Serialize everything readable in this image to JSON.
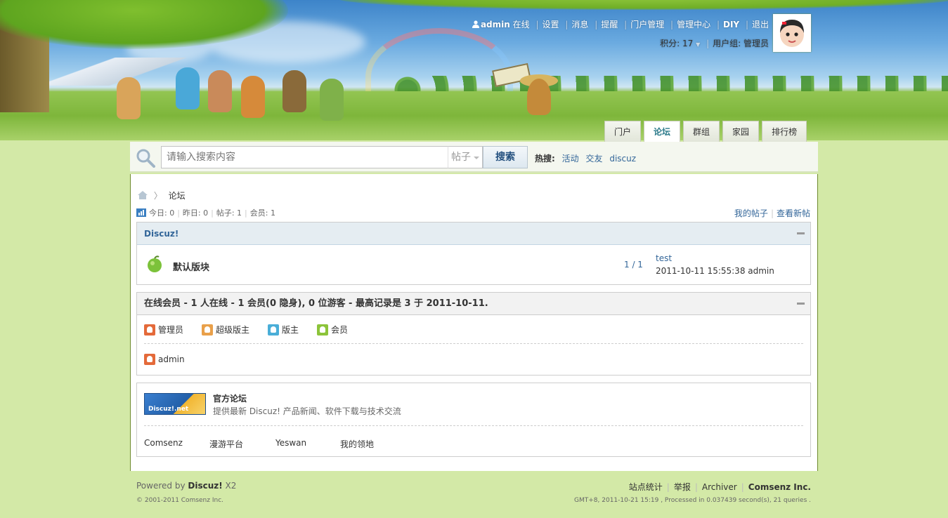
{
  "user_nav": {
    "username": "admin",
    "status": "在线",
    "items": [
      "设置",
      "消息",
      "提醒",
      "门户管理",
      "管理中心",
      "DIY",
      "退出"
    ],
    "credits_label": "积分: 17",
    "usergroup_label": "用户组: 管理员"
  },
  "nav_tabs": [
    {
      "label": "门户",
      "active": false
    },
    {
      "label": "论坛",
      "active": true
    },
    {
      "label": "群组",
      "active": false
    },
    {
      "label": "家园",
      "active": false
    },
    {
      "label": "排行榜",
      "active": false
    }
  ],
  "search": {
    "placeholder": "请输入搜索内容",
    "type": "帖子",
    "button": "搜索",
    "hot_label": "热搜:",
    "hot_terms": [
      "活动",
      "交友",
      "discuz"
    ]
  },
  "breadcrumb": {
    "current": "论坛"
  },
  "stats": {
    "today": "今日: 0",
    "yesterday": "昨日: 0",
    "posts": "帖子: 1",
    "members": "会员: 1"
  },
  "top_links": [
    "我的帖子",
    "查看新帖"
  ],
  "forum_category": {
    "title": "Discuz!",
    "forum": {
      "name": "默认版块",
      "counts": "1 / 1",
      "last_post_title": "test",
      "last_post_info": "2011-10-11 15:55:38 admin"
    }
  },
  "online": {
    "title": "在线会员 - 1 人在线 - 1 会员(0 隐身), 0 位游客 - 最高记录是 3 于 2011-10-11.",
    "legend": [
      {
        "label": "管理员",
        "color": "#e46a3a"
      },
      {
        "label": "超级版主",
        "color": "#e9a04a"
      },
      {
        "label": "版主",
        "color": "#4aaed8"
      },
      {
        "label": "会员",
        "color": "#8cc43a"
      }
    ],
    "users": [
      {
        "name": "admin",
        "color": "#e46a3a"
      }
    ]
  },
  "links": {
    "logo_text": "Discuz!.net",
    "name": "官方论坛",
    "description": "提供最新 Discuz! 产品新闻、软件下载与技术交流",
    "items": [
      "Comsenz",
      "漫游平台",
      "Yeswan",
      "我的领地"
    ]
  },
  "footer": {
    "powered_prefix": "Powered by ",
    "powered_brand": "Discuz!",
    "powered_version": " X2",
    "copyright": "© 2001-2011 Comsenz Inc.",
    "links": [
      "站点统计",
      "举报",
      "Archiver"
    ],
    "company": "Comsenz Inc.",
    "debug": "GMT+8, 2011-10-21 15:19 , Processed in 0.037439 second(s), 21 queries ."
  },
  "colors": {
    "link": "#336699",
    "page_bg": "#d3e9a7",
    "active_tab": "#2b7a8a"
  }
}
